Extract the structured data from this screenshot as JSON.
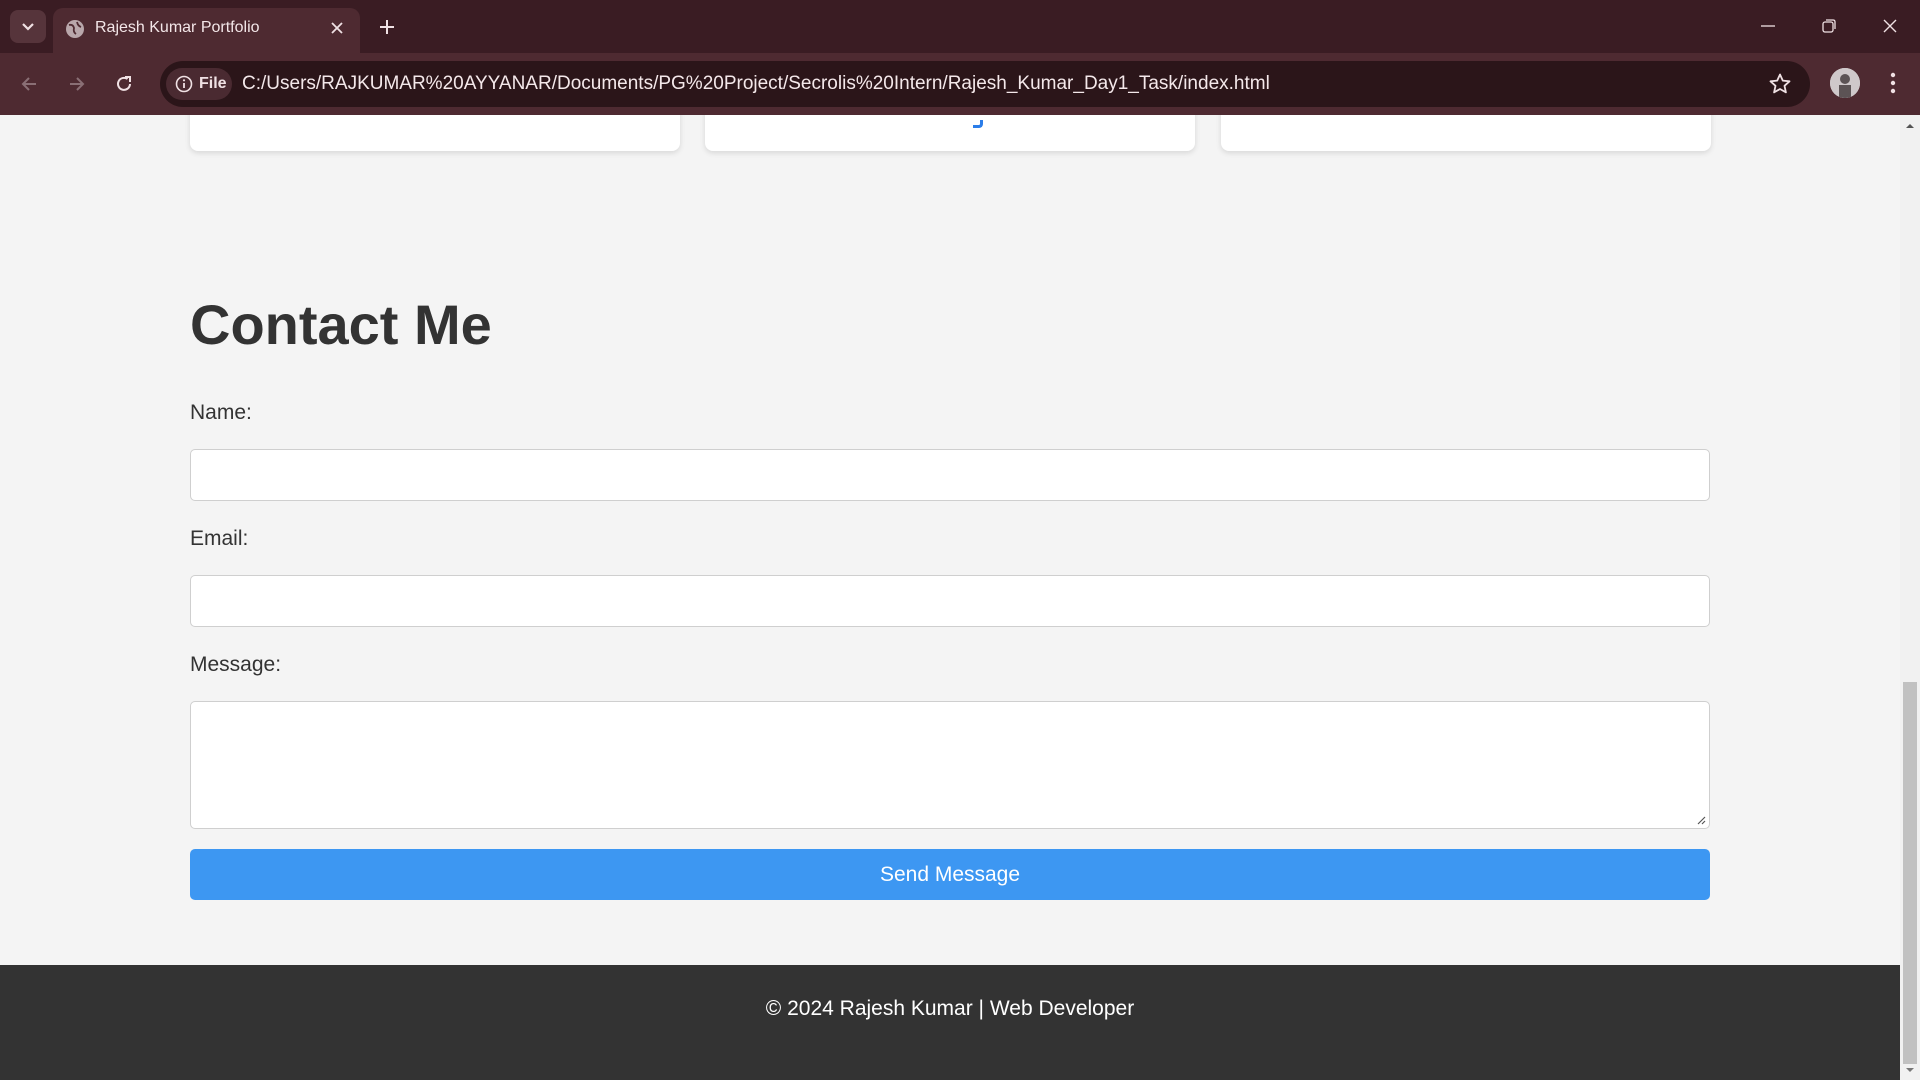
{
  "browser": {
    "tab_title": "Rajesh Kumar Portfolio",
    "address_chip": "File",
    "url": "C:/Users/RAJKUMAR%20AYYANAR/Documents/PG%20Project/Secrolis%20Intern/Rajesh_Kumar_Day1_Task/index.html"
  },
  "contact": {
    "title": "Contact Me",
    "name_label": "Name:",
    "name_value": "",
    "email_label": "Email:",
    "email_value": "",
    "message_label": "Message:",
    "message_value": "",
    "submit_label": "Send Message"
  },
  "footer": {
    "text": "© 2024 Rajesh Kumar | Web Developer"
  },
  "colors": {
    "browser_frame": "#3a1c23",
    "page_background": "#f4f4f4",
    "button": "#3d97f2",
    "footer": "#333333"
  },
  "icons": [
    "tab-list-icon",
    "globe-icon",
    "close-icon",
    "plus-icon",
    "minimize-icon",
    "restore-icon",
    "back-arrow-icon",
    "forward-arrow-icon",
    "reload-icon",
    "info-icon",
    "star-icon",
    "profile-icon",
    "more-icon"
  ]
}
